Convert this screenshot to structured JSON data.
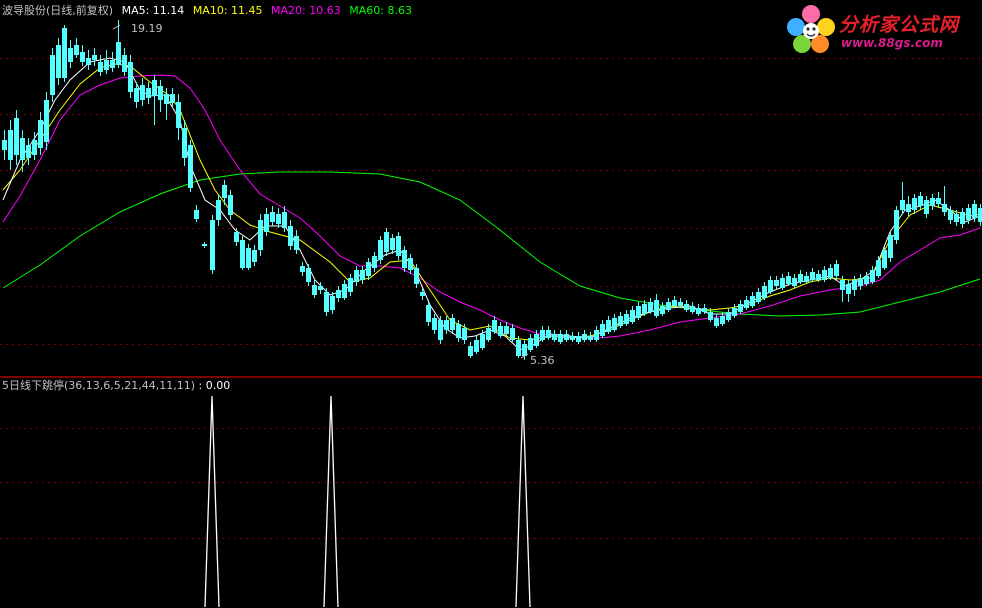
{
  "stock": {
    "name": "波导股份",
    "mode": "(日线,前复权)"
  },
  "indicators": {
    "ma5": {
      "label": "MA5: 11.14",
      "color": "#ffffff"
    },
    "ma10": {
      "label": "MA10: 11.45",
      "color": "#ffff00"
    },
    "ma20": {
      "label": "MA20: 10.63",
      "color": "#ff00ff"
    },
    "ma60": {
      "label": "MA60: 8.63",
      "color": "#00ff00"
    }
  },
  "annotations": {
    "high_label": "19.19",
    "low_label": "5.36"
  },
  "sub_indicator": {
    "label": "5日线下跳停(36,13,6,5,21,44,11,11)",
    "value": ": 0.00"
  },
  "watermark": {
    "cn": "分析家公式网",
    "url": "www.88gs.com"
  },
  "colors": {
    "up": "#ff3232",
    "down": "#54ffff",
    "grid": "#800000",
    "background": "#000000",
    "text": "#c0c0c0"
  }
}
